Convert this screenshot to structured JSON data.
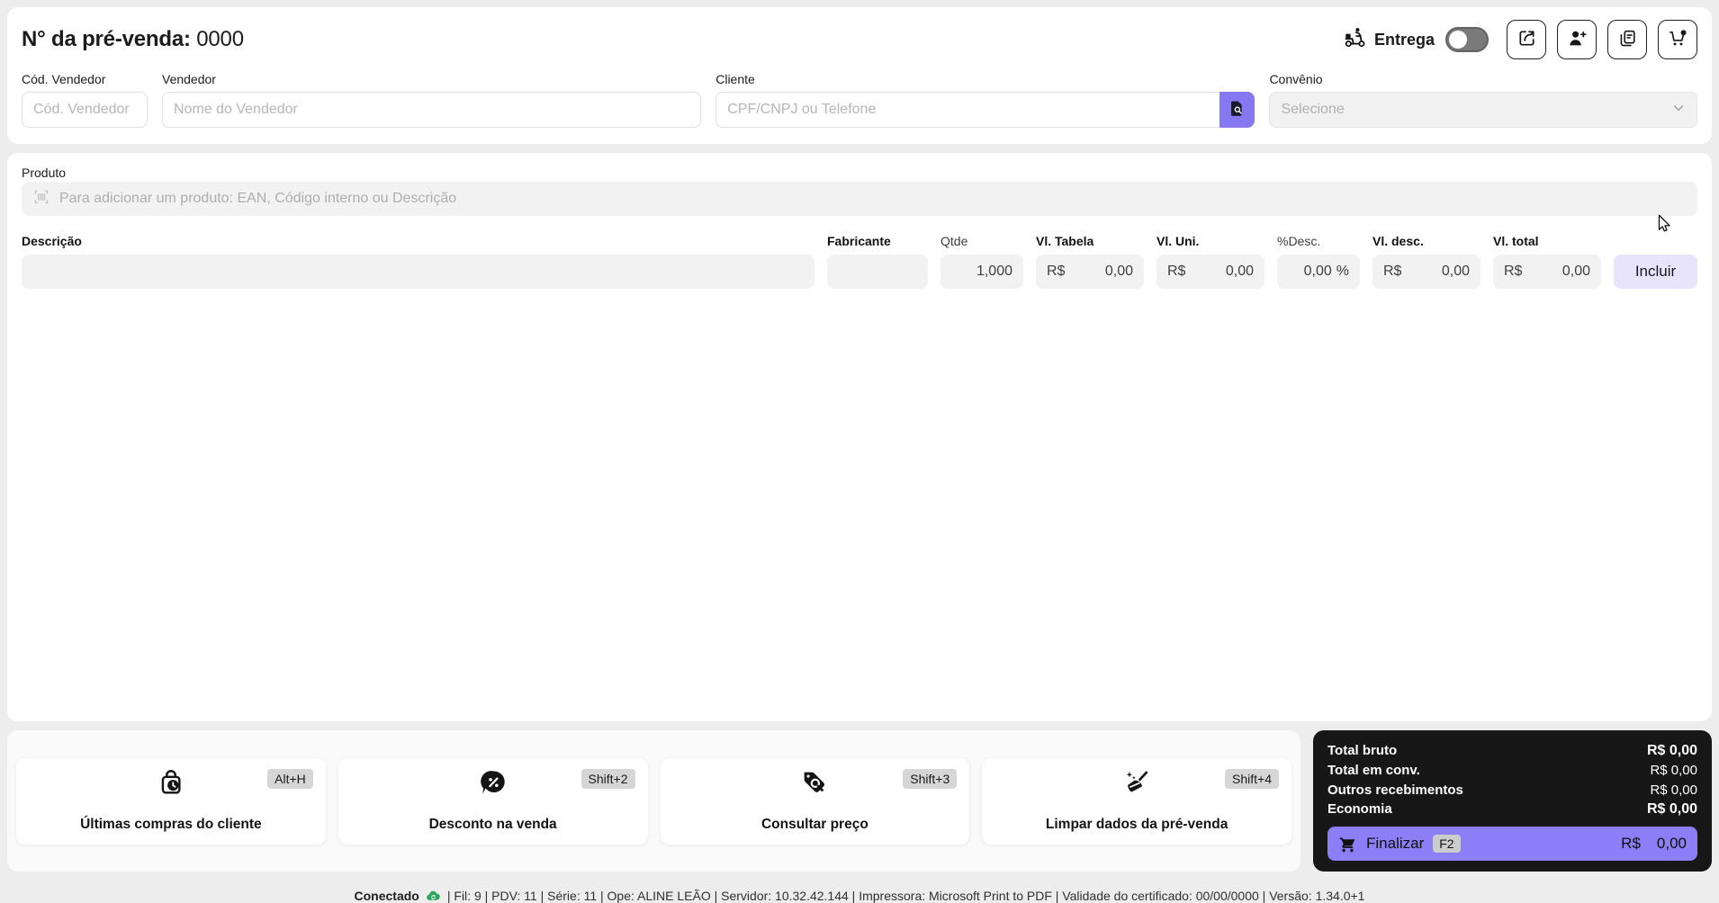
{
  "colors": {
    "accent_purple": "#8678f0",
    "accent_purple_light": "#e8e4fb",
    "finalize_purple": "#8b7ef7",
    "panel_black": "#171717",
    "connected_green": "#2fa45c"
  },
  "header": {
    "presale_label": "N° da pré-venda:",
    "presale_number": "0000",
    "delivery_label": "Entrega"
  },
  "form": {
    "vendor_code_label": "Cód. Vendedor",
    "vendor_code_placeholder": "Cód. Vendedor",
    "vendor_label": "Vendedor",
    "vendor_placeholder": "Nome do Vendedor",
    "client_label": "Cliente",
    "client_placeholder": "CPF/CNPJ ou Telefone",
    "agreement_label": "Convênio",
    "agreement_placeholder": "Selecione"
  },
  "product": {
    "label": "Produto",
    "placeholder": "Para adicionar um produto: EAN, Código interno ou Descrição"
  },
  "item_entry": {
    "description_label": "Descrição",
    "manufacturer_label": "Fabricante",
    "qty_label": "Qtde",
    "qty_value": "1,000",
    "table_label": "Vl. Tabela",
    "unit_label": "Vl. Uni.",
    "pct_label": "%Desc.",
    "pct_value": "0,00",
    "pct_suffix": "%",
    "vdesc_label": "Vl. desc.",
    "vtotal_label": "Vl. total",
    "currency_prefix": "R$",
    "zero_value": "0,00",
    "include_label": "Incluir"
  },
  "actions": [
    {
      "label": "Últimas compras do cliente",
      "shortcut": "Alt+H",
      "icon": "bag-clock-icon"
    },
    {
      "label": "Desconto na venda",
      "shortcut": "Shift+2",
      "icon": "discount-chat-icon"
    },
    {
      "label": "Consultar preço",
      "shortcut": "Shift+3",
      "icon": "price-tag-search-icon"
    },
    {
      "label": "Limpar dados da pré-venda",
      "shortcut": "Shift+4",
      "icon": "broom-icon"
    }
  ],
  "summary": {
    "rows": [
      {
        "label": "Total bruto",
        "value": "R$ 0,00"
      },
      {
        "label": "Total em conv.",
        "value": "R$ 0,00"
      },
      {
        "label": "Outros recebimentos",
        "value": "R$ 0,00"
      },
      {
        "label": "Economia",
        "value": "R$ 0,00"
      }
    ],
    "finalize_label": "Finalizar",
    "finalize_shortcut": "F2",
    "finalize_prefix": "R$",
    "finalize_value": "0,00"
  },
  "statusbar": {
    "connected_label": "Conectado",
    "details": "| Fil: 9 | PDV: 11 | Série: 11 | Ope: ALINE LEÃO | Servidor: 10.32.42.144 | Impressora: Microsoft Print to PDF | Validade do certificado: 00/00/0000 | Versão: 1.34.0+1"
  }
}
